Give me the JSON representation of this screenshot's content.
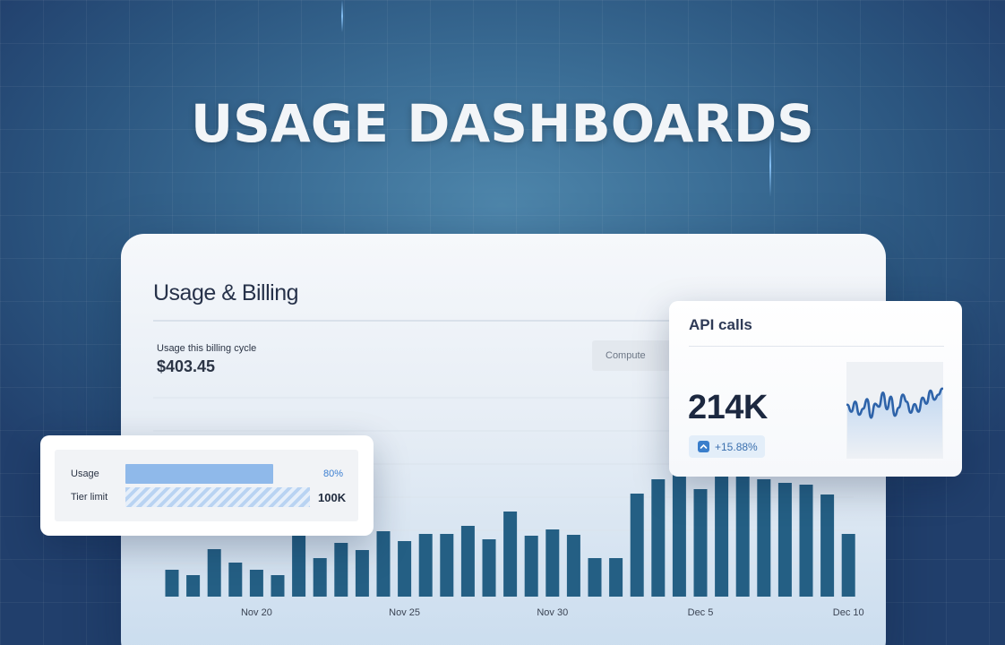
{
  "hero": {
    "title": "USAGE DASHBOARDS"
  },
  "main": {
    "title": "Usage & Billing",
    "cycle_label": "Usage this billing cycle",
    "cycle_value": "$403.45",
    "compute_label": "Compute"
  },
  "usage_card": {
    "usage_label": "Usage",
    "usage_percent": "80%",
    "usage_fraction": 0.8,
    "tier_label": "Tier limit",
    "tier_value": "100K"
  },
  "api_card": {
    "title": "API calls",
    "value": "214K",
    "change": "+15.88%",
    "sparkline": [
      0.46,
      0.6,
      0.4,
      0.66,
      0.54,
      0.35,
      0.72,
      0.44,
      0.5,
      0.22,
      0.55,
      0.3,
      0.68,
      0.52,
      0.26,
      0.4,
      0.62,
      0.45,
      0.6,
      0.32,
      0.44,
      0.18,
      0.36,
      0.26,
      0.14
    ]
  },
  "chart_data": {
    "type": "bar",
    "x_tick_labels": [
      "Nov 20",
      "Nov 25",
      "Nov 30",
      "Dec 5",
      "Dec 10"
    ],
    "values": [
      30,
      24,
      53,
      38,
      30,
      24,
      68,
      43,
      60,
      52,
      73,
      62,
      70,
      70,
      79,
      64,
      95,
      68,
      75,
      69,
      43,
      43,
      115,
      131,
      147,
      120,
      137,
      142,
      131,
      127,
      125,
      114,
      70
    ],
    "ylim": [
      0,
      150
    ],
    "color": "#245f84"
  }
}
